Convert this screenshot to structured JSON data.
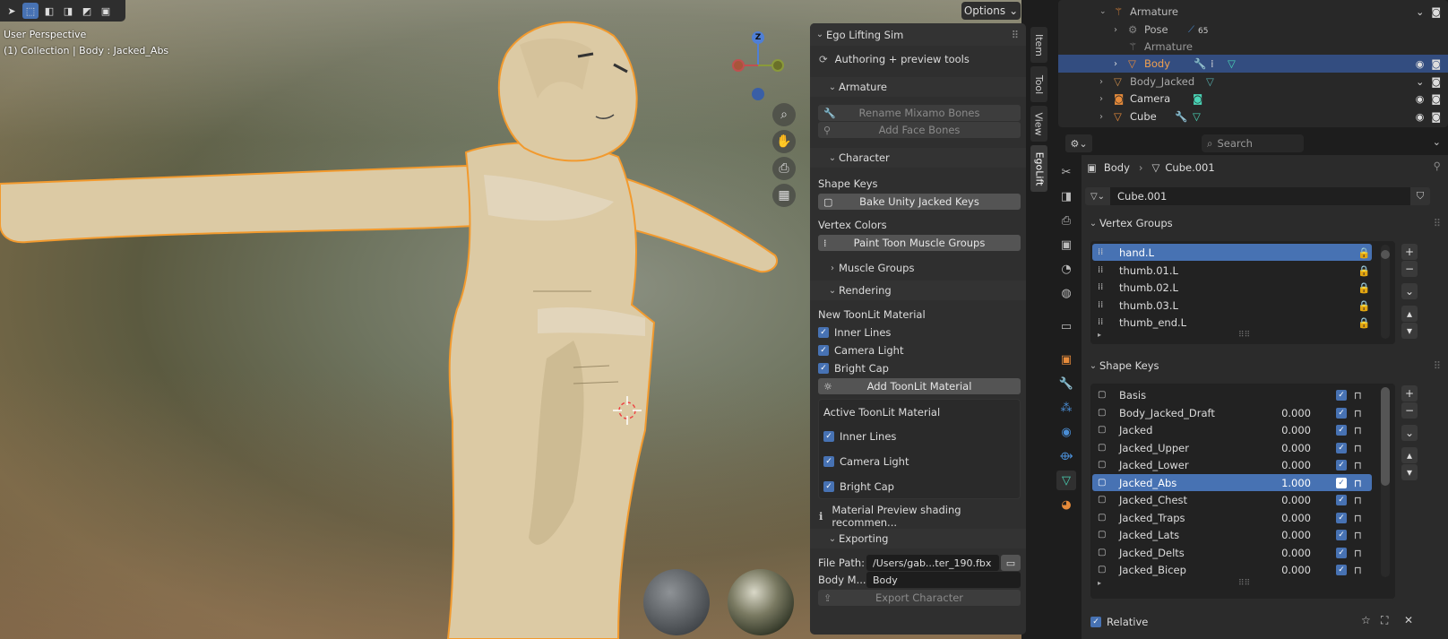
{
  "viewport": {
    "perspective": "User Perspective",
    "collection_info": "(1) Collection | Body : Jacked_Abs",
    "options_label": "Options",
    "gizmo_z": "Z"
  },
  "npanel": {
    "title": "Ego Lifting Sim",
    "subtitle": "Authoring + preview tools",
    "armature": {
      "label": "Armature",
      "rename_btn": "Rename Mixamo Bones",
      "face_btn": "Add Face Bones"
    },
    "character": {
      "label": "Character",
      "shape_keys_label": "Shape Keys",
      "bake_btn": "Bake Unity Jacked Keys",
      "vertex_colors_label": "Vertex Colors",
      "paint_btn": "Paint Toon Muscle Groups",
      "muscle_groups": "Muscle Groups"
    },
    "rendering": {
      "label": "Rendering",
      "new_material_label": "New ToonLit Material",
      "new_checks": [
        "Inner Lines",
        "Camera Light",
        "Bright Cap"
      ],
      "add_btn": "Add ToonLit Material",
      "active_material_label": "Active ToonLit Material",
      "active_checks": [
        "Inner Lines",
        "Camera Light",
        "Bright Cap"
      ],
      "info": "Material Preview shading recommen..."
    },
    "exporting": {
      "label": "Exporting",
      "file_path_label": "File Path:",
      "file_path_value": "/Users/gab...ter_190.fbx",
      "body_mesh_label": "Body M...",
      "body_mesh_value": "Body",
      "export_btn": "Export Character"
    }
  },
  "vtabs": [
    "Item",
    "Tool",
    "View",
    "EgoLift"
  ],
  "outliner": {
    "rows": [
      {
        "name": "Armature",
        "indent": 1
      },
      {
        "name": "Pose",
        "indent": 2,
        "badge": "65"
      },
      {
        "name": "Armature",
        "indent": 2
      },
      {
        "name": "Body",
        "indent": 2
      },
      {
        "name": "Body_Jacked",
        "indent": 1
      },
      {
        "name": "Camera",
        "indent": 1
      },
      {
        "name": "Cube",
        "indent": 1
      }
    ]
  },
  "properties": {
    "search_placeholder": "Search",
    "breadcrumb_object": "Body",
    "breadcrumb_mesh": "Cube.001",
    "mesh_name": "Cube.001",
    "vertex_groups": {
      "label": "Vertex Groups",
      "items": [
        "hand.L",
        "thumb.01.L",
        "thumb.02.L",
        "thumb.03.L",
        "thumb_end.L"
      ]
    },
    "shape_keys": {
      "label": "Shape Keys",
      "items": [
        {
          "name": "Basis",
          "value": ""
        },
        {
          "name": "Body_Jacked_Draft",
          "value": "0.000"
        },
        {
          "name": "Jacked",
          "value": "0.000"
        },
        {
          "name": "Jacked_Upper",
          "value": "0.000"
        },
        {
          "name": "Jacked_Lower",
          "value": "0.000"
        },
        {
          "name": "Jacked_Abs",
          "value": "1.000"
        },
        {
          "name": "Jacked_Chest",
          "value": "0.000"
        },
        {
          "name": "Jacked_Traps",
          "value": "0.000"
        },
        {
          "name": "Jacked_Lats",
          "value": "0.000"
        },
        {
          "name": "Jacked_Delts",
          "value": "0.000"
        },
        {
          "name": "Jacked_Bicep",
          "value": "0.000"
        }
      ],
      "relative_label": "Relative"
    }
  }
}
